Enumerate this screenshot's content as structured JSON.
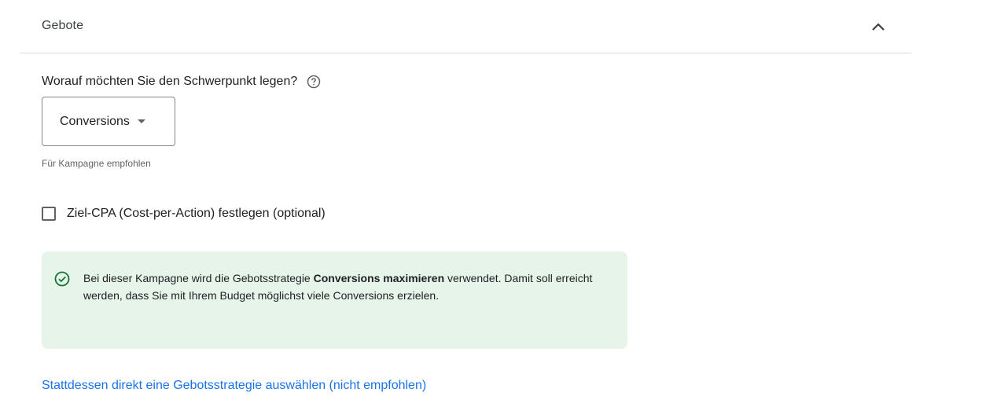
{
  "section": {
    "title": "Gebote"
  },
  "focus": {
    "question": "Worauf möchten Sie den Schwerpunkt legen?",
    "selected": "Conversions",
    "helper": "Für Kampagne empfohlen"
  },
  "target_cpa": {
    "label": "Ziel-CPA (Cost-per-Action) festlegen (optional)",
    "checked": false
  },
  "info": {
    "text_before": "Bei dieser Kampagne wird die Gebotsstrategie ",
    "strategy": "Conversions maximieren",
    "text_after": " verwendet. Damit soll erreicht werden, dass Sie mit Ihrem Budget möglichst viele Conversions erzielen."
  },
  "link": {
    "label": "Stattdessen direkt eine Gebotsstrategie auswählen (nicht empfohlen)"
  },
  "colors": {
    "link": "#1a73e8",
    "info_bg": "#e6f4ea",
    "success_icon": "#137333",
    "divider": "#dadce0"
  },
  "icons": {
    "collapse": "chevron-up-icon",
    "help": "help-circle-icon",
    "dropdown": "arrow-drop-down-icon",
    "info": "check-circle-icon"
  }
}
